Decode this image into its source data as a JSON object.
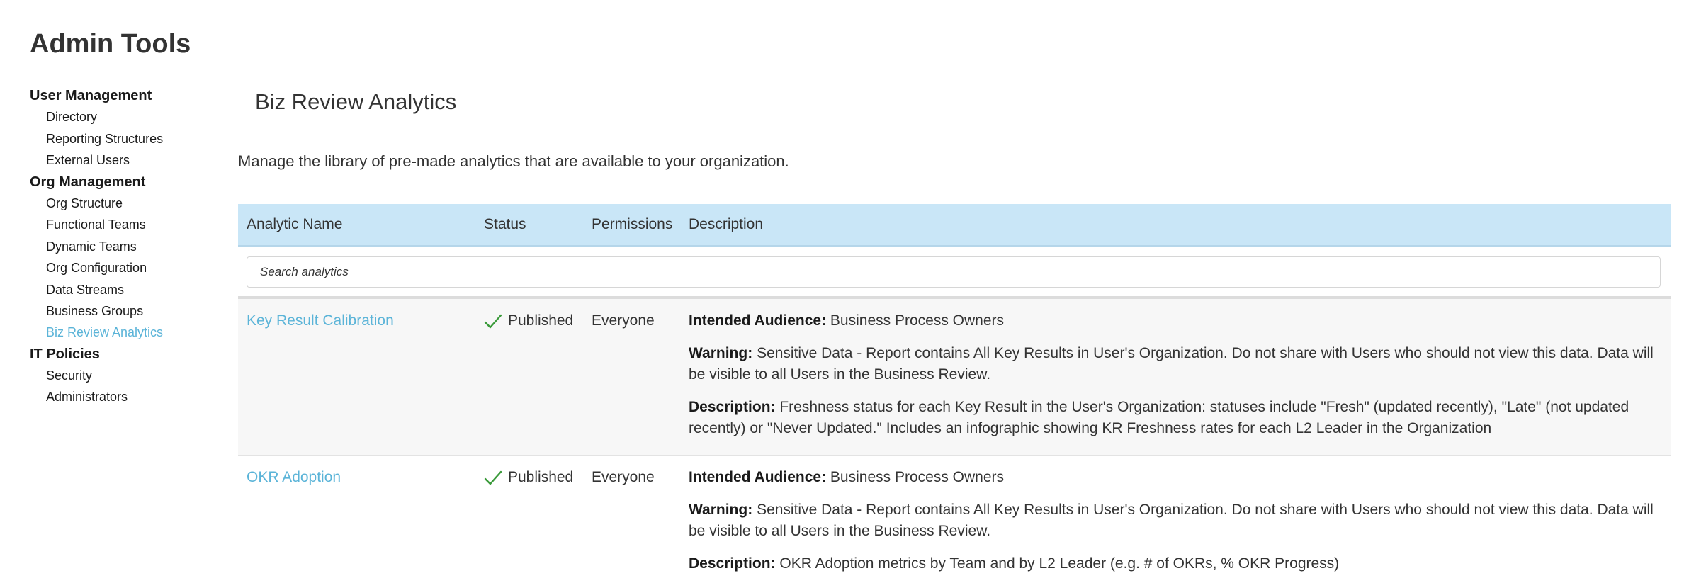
{
  "sidebar": {
    "title": "Admin Tools",
    "sections": [
      {
        "label": "User Management",
        "items": [
          "Directory",
          "Reporting Structures",
          "External Users"
        ]
      },
      {
        "label": "Org Management",
        "items": [
          "Org Structure",
          "Functional Teams",
          "Dynamic Teams",
          "Org Configuration",
          "Data Streams",
          "Business Groups",
          "Biz Review Analytics"
        ]
      },
      {
        "label": "IT Policies",
        "items": [
          "Security",
          "Administrators"
        ]
      }
    ],
    "active_item": "Biz Review Analytics"
  },
  "main": {
    "title": "Biz Review Analytics",
    "subtitle": "Manage the library of pre-made analytics that are available to your organization.",
    "table": {
      "columns": [
        "Analytic Name",
        "Status",
        "Permissions",
        "Description"
      ],
      "search_placeholder": "Search analytics",
      "rows": [
        {
          "name": "Key Result Calibration",
          "status": "Published",
          "permissions": "Everyone",
          "audience_label": "Intended Audience:",
          "audience": "Business Process Owners",
          "warning_label": "Warning:",
          "warning": "Sensitive Data - Report contains All Key Results in User's Organization. Do not share with Users who should not view this data. Data will be visible to all Users in the Business Review.",
          "description_label": "Description:",
          "description": "Freshness status for each Key Result in the User's Organization: statuses include \"Fresh\" (updated recently), \"Late\" (not updated recently) or \"Never Updated.\" Includes an infographic showing KR Freshness rates for each L2 Leader in the Organization"
        },
        {
          "name": "OKR Adoption",
          "status": "Published",
          "permissions": "Everyone",
          "audience_label": "Intended Audience:",
          "audience": "Business Process Owners",
          "warning_label": "Warning:",
          "warning": "Sensitive Data - Report contains All Key Results in User's Organization. Do not share with Users who should not view this data. Data will be visible to all Users in the Business Review.",
          "description_label": "Description:",
          "description": "OKR Adoption metrics by Team and by L2 Leader (e.g. # of OKRs, % OKR Progress)"
        }
      ]
    }
  },
  "colors": {
    "accent": "#5bb4d8",
    "header_bg": "#c9e6f7",
    "check": "#3a9a3a",
    "alt_row_bg": "#f7f7f7"
  },
  "icons": {
    "status_published": "check-icon"
  }
}
